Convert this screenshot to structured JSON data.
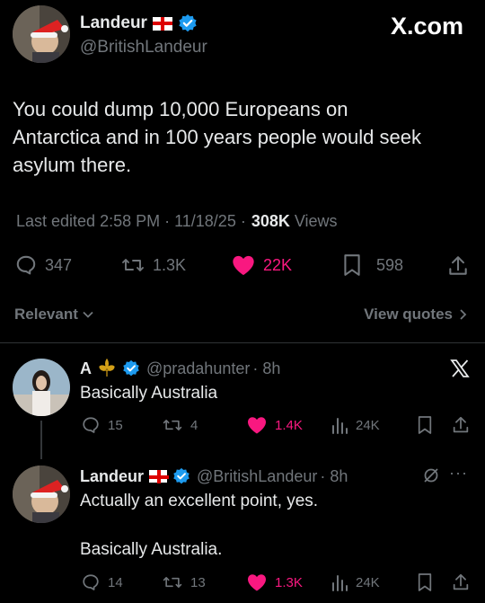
{
  "header": {
    "display_name": "Landeur",
    "handle": "@BritishLandeur",
    "site_label": "X.com"
  },
  "post": {
    "text_line1": "You could dump 10,000 Europeans on",
    "text_line2": "Antarctica and in 100 years people would seek",
    "text_line3": "asylum there.",
    "edited_label": "Last edited 2:58 PM · 11/18/25 ·",
    "views_count": "308K",
    "views_label": "Views",
    "replies": "347",
    "reposts": "1.3K",
    "likes": "22K",
    "bookmarks": "598"
  },
  "sort": {
    "relevant_label": "Relevant",
    "view_quotes_label": "View quotes"
  },
  "reply1": {
    "display_name": "A",
    "handle": "@pradahunter",
    "time": "· 8h",
    "text": "Basically Australia",
    "replies": "15",
    "reposts": "4",
    "likes": "1.4K",
    "views": "24K"
  },
  "reply2": {
    "display_name": "Landeur",
    "handle": "@BritishLandeur",
    "time": "· 8h",
    "text_line1": "Actually an excellent point, yes.",
    "text_line2": "Basically Australia.",
    "replies": "14",
    "reposts": "13",
    "likes": "1.3K",
    "views": "24K"
  },
  "colors": {
    "like": "#f91880",
    "verified": "#1d9bf0",
    "muted": "#71767b"
  }
}
